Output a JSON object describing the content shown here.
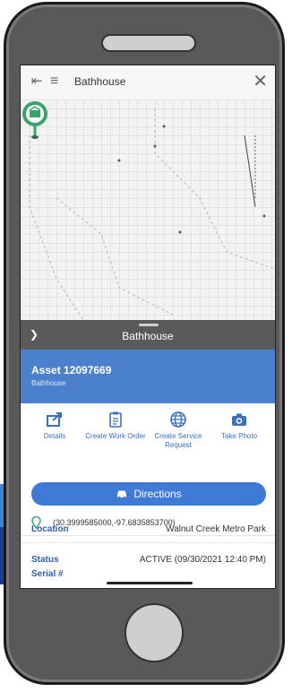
{
  "topbar": {
    "title": "Bathhouse"
  },
  "sheet": {
    "title": "Bathhouse"
  },
  "asset": {
    "id_label": "Asset 12097669",
    "type": "Bathhouse"
  },
  "actions": [
    {
      "label": "Details",
      "icon": "share-icon"
    },
    {
      "label": "Create Work Order",
      "icon": "clipboard-icon"
    },
    {
      "label": "Create Service Request",
      "icon": "globe-icon"
    },
    {
      "label": "Take Photo",
      "icon": "camera-icon"
    }
  ],
  "directions": {
    "label": "Directions"
  },
  "details": {
    "coordinates": "(30.3999585000,-97.6835853700)",
    "location_label": "Location",
    "location_value": "Walnut Creek Metro Park",
    "status_label": "Status",
    "status_value": "ACTIVE (09/30/2021 12:40 PM)",
    "serial_label": "Serial #",
    "serial_value": ""
  },
  "colors": {
    "accent": "#4a80cc",
    "pin": "#3aa36b",
    "sheet_header": "#5a5a5a",
    "label_blue": "#2f5ea8"
  }
}
